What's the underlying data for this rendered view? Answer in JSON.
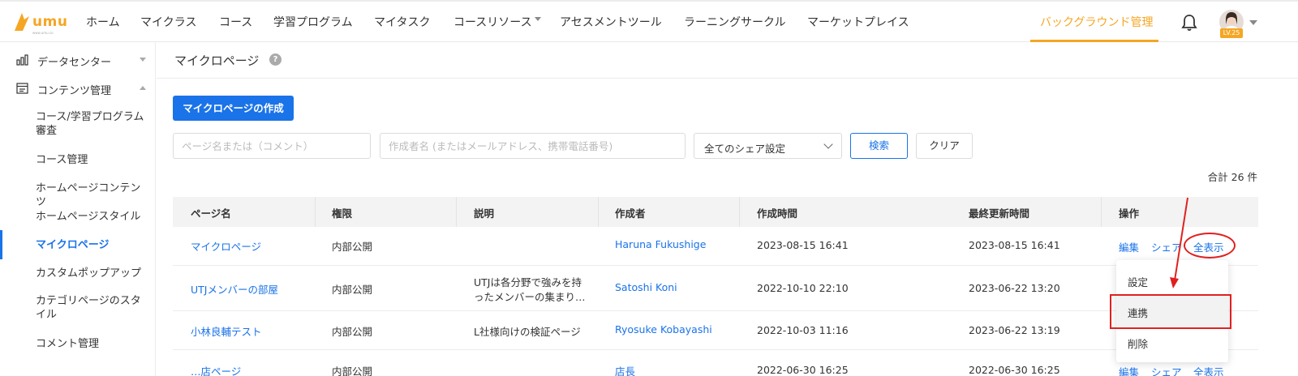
{
  "brand": {
    "name": "umu",
    "tagline": "www.umu.co"
  },
  "topnav": {
    "items": [
      "ホーム",
      "マイクラス",
      "コース",
      "学習プログラム",
      "マイタスク",
      "コースリソース",
      "アセスメントツール",
      "ラーニングサークル",
      "マーケットプレイス"
    ],
    "admin": "バックグラウンド管理",
    "level": "LV.25"
  },
  "sidebar": {
    "groups": [
      "データセンター",
      "コンテンツ管理"
    ],
    "items": [
      "コース/学習プログラム審査",
      "コース管理",
      "ホームページコンテンツ",
      "ホームページスタイル",
      "マイクロページ",
      "カスタムポップアップ",
      "カテゴリページのスタイル",
      "コメント管理"
    ]
  },
  "page": {
    "title": "マイクロページ",
    "help": "?",
    "create_button": "マイクロページの作成",
    "search_name_placeholder": "ページ名または（コメント）",
    "search_author_placeholder": "作成者名 (またはメールアドレス、携帯電話番号)",
    "share_select": "全てのシェア設定",
    "search_button": "検索",
    "clear_button": "クリア",
    "total": "合計 26 件"
  },
  "table": {
    "headers": [
      "ページ名",
      "権限",
      "説明",
      "作成者",
      "作成時間",
      "最終更新時間",
      "操作"
    ],
    "rows": [
      {
        "name": "マイクロページ",
        "perm": "内部公開",
        "desc": "",
        "author": "Haruna Fukushige",
        "created": "2023-08-15 16:41",
        "updated": "2023-08-15 16:41"
      },
      {
        "name": "UTJメンバーの部屋",
        "perm": "内部公開",
        "desc_1": "UTJは各分野で強みを持",
        "desc_2": "ったメンバーの集まり…",
        "author": "Satoshi Koni",
        "created": "2022-10-10 22:10",
        "updated": "2023-06-22 13:20"
      },
      {
        "name": "小林良輔テスト",
        "perm": "内部公開",
        "desc": "L社様向けの検証ページ",
        "author": "Ryosuke Kobayashi",
        "created": "2022-10-03 11:16",
        "updated": "2023-06-22 13:19"
      },
      {
        "name": "…店ページ",
        "perm": "内部公開",
        "author": "店長",
        "created": "2022-06-30 16:25",
        "updated": "2022-06-30 16:25"
      }
    ],
    "ops": {
      "edit": "編集",
      "share": "シェア",
      "show_all": "全表示"
    }
  },
  "menu": {
    "items": [
      "設定",
      "連携",
      "削除"
    ]
  },
  "colors": {
    "accent": "#1a73e8",
    "brand": "#f5a623",
    "annotation": "#e02020"
  }
}
